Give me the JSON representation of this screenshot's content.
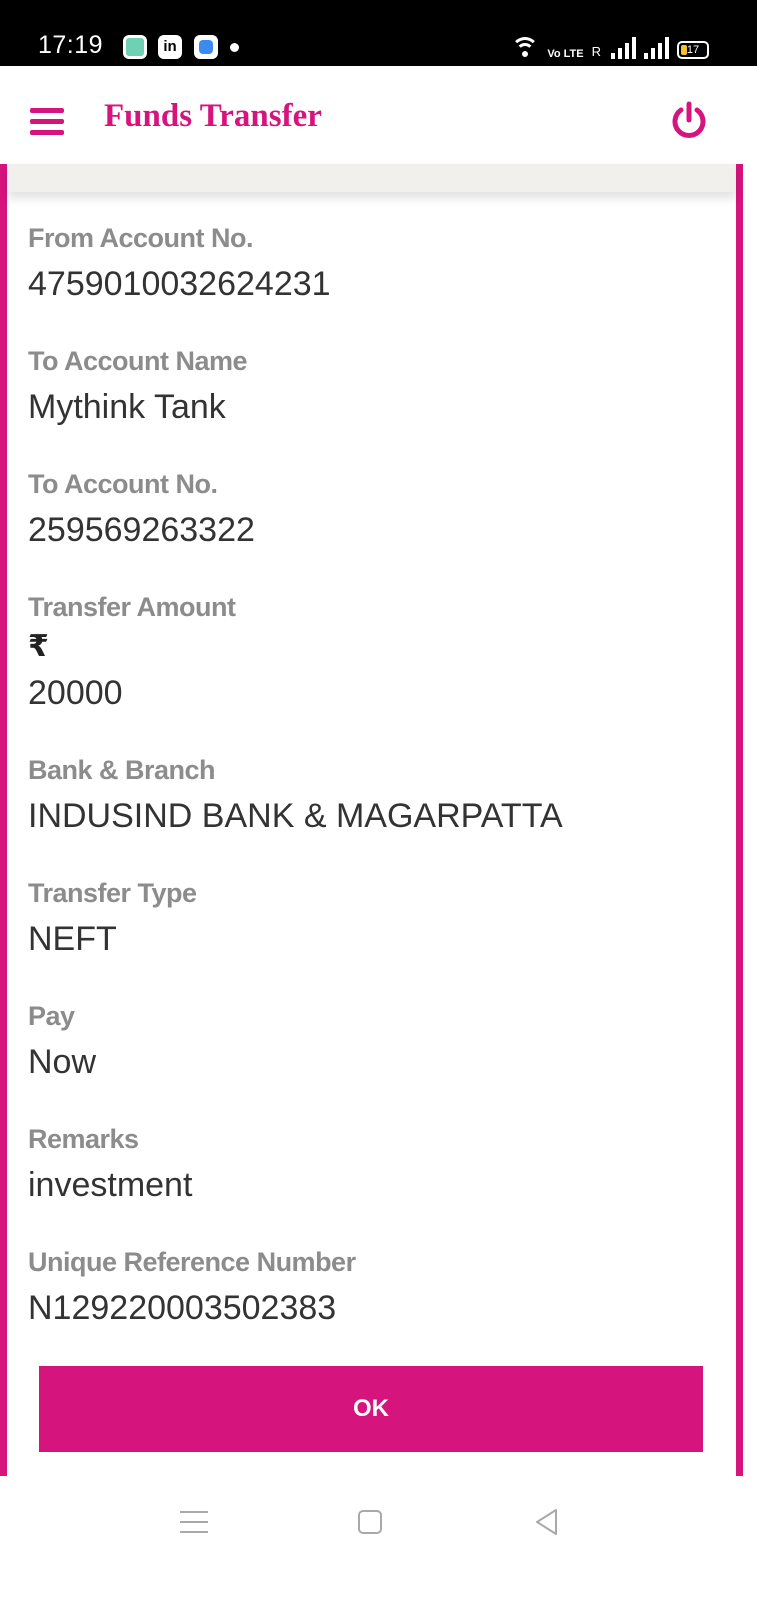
{
  "status_bar": {
    "time": "17:19",
    "app_icons": [
      "chat-app-icon",
      "linkedin-icon",
      "messaging-app-icon"
    ],
    "signal_label": "R",
    "volte_label": "Vo LTE",
    "battery": "17"
  },
  "header": {
    "title": "Funds Transfer"
  },
  "fields": {
    "from_account": {
      "label": "From Account No.",
      "value": "4759010032624231"
    },
    "to_account_name": {
      "label": "To Account Name",
      "value": "Mythink Tank"
    },
    "to_account_no": {
      "label": "To Account No.",
      "value": "259569263322"
    },
    "transfer_amount": {
      "label": "Transfer Amount",
      "currency": "₹",
      "value": "20000"
    },
    "bank_branch": {
      "label": "Bank & Branch",
      "value": "INDUSIND BANK & MAGARPATTA"
    },
    "transfer_type": {
      "label": "Transfer Type",
      "value": "NEFT"
    },
    "pay": {
      "label": "Pay",
      "value": "Now"
    },
    "remarks": {
      "label": "Remarks",
      "value": "investment"
    },
    "urn": {
      "label": "Unique Reference Number",
      "value": "N129220003502383"
    }
  },
  "actions": {
    "ok_label": "OK"
  },
  "colors": {
    "brand": "#d6147e",
    "label": "#8c8c8c",
    "value": "#333333"
  }
}
